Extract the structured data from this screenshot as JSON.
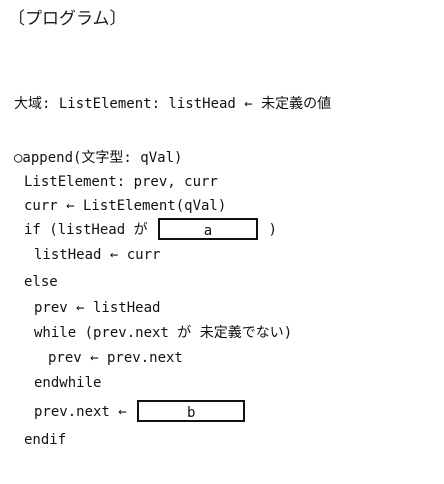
{
  "heading": "〔プログラム〕",
  "lines": {
    "global": "大域: ListElement: listHead ← 未定義の値",
    "func": "○append(文字型: qVal)",
    "decl": "ListElement: prev, curr",
    "assign_curr": "curr ← ListElement(qVal)",
    "if_prefix": "if (listHead が",
    "if_suffix": ")",
    "blank_a": "a",
    "head_assign": "listHead ← curr",
    "else": "else",
    "prev_assign": "prev ← listHead",
    "while": "while (prev.next が 未定義でない)",
    "prev_next": "prev ← prev.next",
    "endwhile": "endwhile",
    "prev_next_assign_prefix": "prev.next ←",
    "blank_b": "b",
    "endif": "endif"
  }
}
